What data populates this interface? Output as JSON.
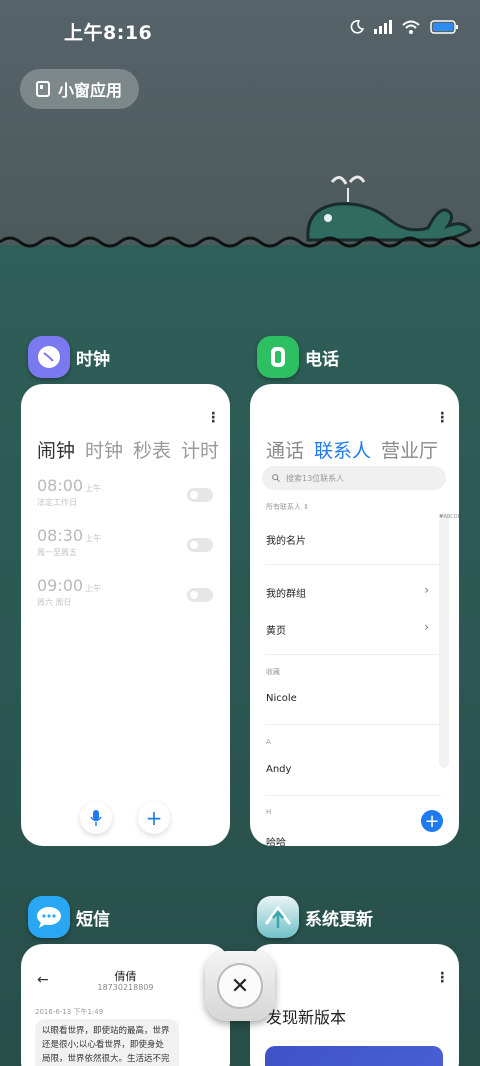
{
  "status_bar": {
    "time": "上午8:16"
  },
  "float_window": {
    "label": "小窗应用"
  },
  "clock_app": {
    "name": "时钟",
    "tabs": [
      "闹钟",
      "时钟",
      "秒表",
      "计时"
    ],
    "alarms": [
      {
        "time": "08:00",
        "ampm": "上午",
        "repeat": "法定工作日"
      },
      {
        "time": "08:30",
        "ampm": "上午",
        "repeat": "周一至周五"
      },
      {
        "time": "09:00",
        "ampm": "上午",
        "repeat": "周六 周日"
      }
    ]
  },
  "phone_app": {
    "name": "电话",
    "tabs": [
      "通话",
      "联系人",
      "营业厅"
    ],
    "search_placeholder": "搜索13位联系人",
    "filter_label": "所有联系人",
    "my_card": "我的名片",
    "my_groups": "我的群组",
    "yellow_pages": "黄页",
    "favorites_header": "收藏",
    "favorite": "Nicole",
    "section_a": "A",
    "contact_a": "Andy",
    "section_h": "H",
    "contact_h": "哈哈",
    "index_letters": "♥ABCDEFGHIJKLMNOPQRSTUVWXYZ#"
  },
  "messages_app": {
    "name": "短信",
    "contact_name": "倩倩",
    "contact_number": "18730218809",
    "timestamp": "2016-6-13 下午1:49",
    "message_text": "以眼看世界，即使站的最高，世界还是很小;以心看世界，即使身处局限，世界依然很大。生活远不完"
  },
  "update_app": {
    "name": "系统更新",
    "heading": "发现新版本"
  },
  "colors": {
    "accent": "#1d7bef",
    "clock_icon": "#7b79f0",
    "phone_icon": "#2fbf63",
    "message_icon": "#2aa7f3"
  }
}
